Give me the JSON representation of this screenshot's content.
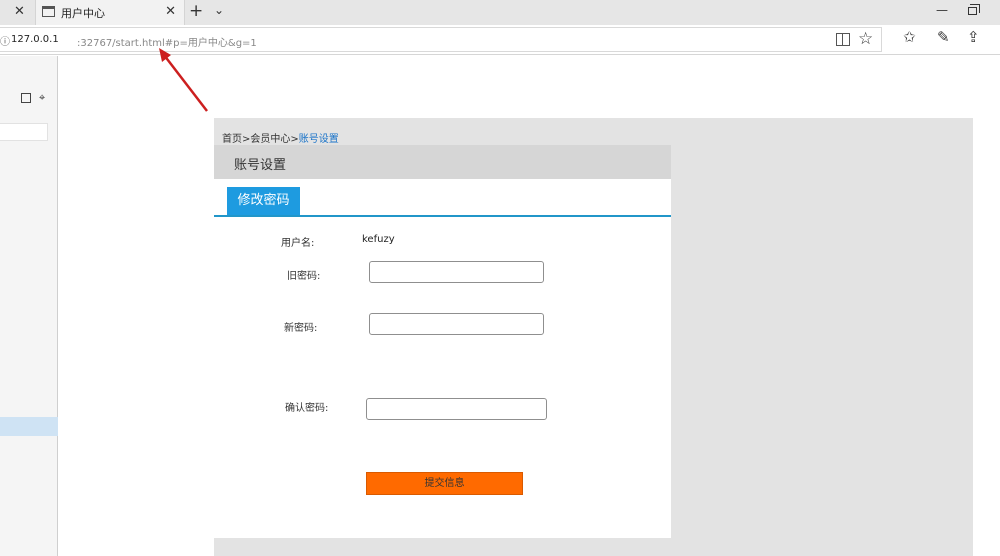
{
  "browser": {
    "prev_tab_close": "✕",
    "active_tab": {
      "title": "用户中心",
      "close": "✕"
    },
    "new_tab": "+",
    "tab_list": "⌄",
    "minimize": "—",
    "address": {
      "leading": "ⓘ",
      "host": "127.0.0.1",
      "rest": ":32767/start.html#p=用户中心&g=1"
    },
    "icons": {
      "favorite": "☆",
      "favorites_hub": "✩",
      "notes": "✎",
      "share": "⇪"
    }
  },
  "sidebar": {
    "cursor_icon": "⌖"
  },
  "breadcrumb": {
    "home": "首页",
    "sep1": ">",
    "member": "会员中心",
    "sep2": ">",
    "current": "账号设置"
  },
  "panel": {
    "title": "账号设置",
    "tab": "修改密码"
  },
  "form": {
    "username_label": "用户名:",
    "username_value": "kefuzy",
    "old_password_label": "旧密码:",
    "new_password_label": "新密码:",
    "confirm_password_label": "确认密码:",
    "submit_label": "提交信息"
  },
  "colors": {
    "accent": "#1e9be0",
    "submit": "#ff6a00",
    "annotation": "#cc1f1f"
  }
}
